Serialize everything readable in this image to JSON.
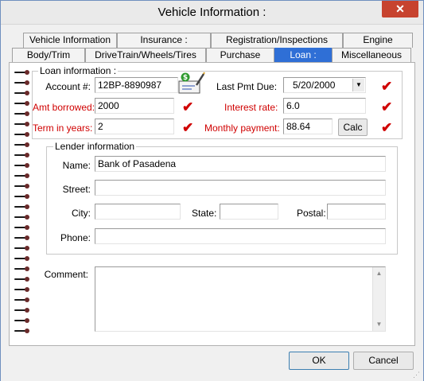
{
  "window": {
    "title": "Vehicle Information :",
    "close_glyph": "✕"
  },
  "tabs_row1": [
    {
      "label": "Vehicle Information"
    },
    {
      "label": "Insurance :"
    },
    {
      "label": "Registration/Inspections"
    },
    {
      "label": "Engine"
    }
  ],
  "tabs_row2": [
    {
      "label": "Body/Trim"
    },
    {
      "label": "DriveTrain/Wheels/Tires"
    },
    {
      "label": "Purchase"
    },
    {
      "label": "Loan :",
      "active": true
    },
    {
      "label": "Miscellaneous"
    }
  ],
  "loan": {
    "legend": "Loan information :",
    "account_label": "Account #:",
    "account_value": "12BP-8890987",
    "last_pmt_label": "Last Pmt Due:",
    "last_pmt_value": "5/20/2000",
    "amt_label": "Amt borrowed:",
    "amt_value": "2000",
    "rate_label": "Interest rate:",
    "rate_value": "6.0",
    "term_label": "Term in years:",
    "term_value": "2",
    "monthly_label": "Monthly payment:",
    "monthly_value": "88.64",
    "calc_label": "Calc",
    "check_glyph": "✔"
  },
  "lender": {
    "legend": "Lender information",
    "name_label": "Name:",
    "name_value": "Bank of Pasadena",
    "street_label": "Street:",
    "street_value": "",
    "city_label": "City:",
    "city_value": "",
    "state_label": "State:",
    "state_value": "",
    "postal_label": "Postal:",
    "postal_value": "",
    "phone_label": "Phone:",
    "phone_value": ""
  },
  "comment": {
    "label": "Comment:",
    "value": ""
  },
  "footer": {
    "ok_label": "OK",
    "cancel_label": "Cancel"
  },
  "colors": {
    "accent": "#2f6fd6",
    "required_label": "#d00000",
    "check": "#d00000",
    "close": "#c7432f"
  },
  "icons": [
    "close-icon",
    "check-icon",
    "payment-icon",
    "dropdown-arrow-icon",
    "scroll-up-icon",
    "scroll-down-icon",
    "spiral-binding-icon"
  ]
}
